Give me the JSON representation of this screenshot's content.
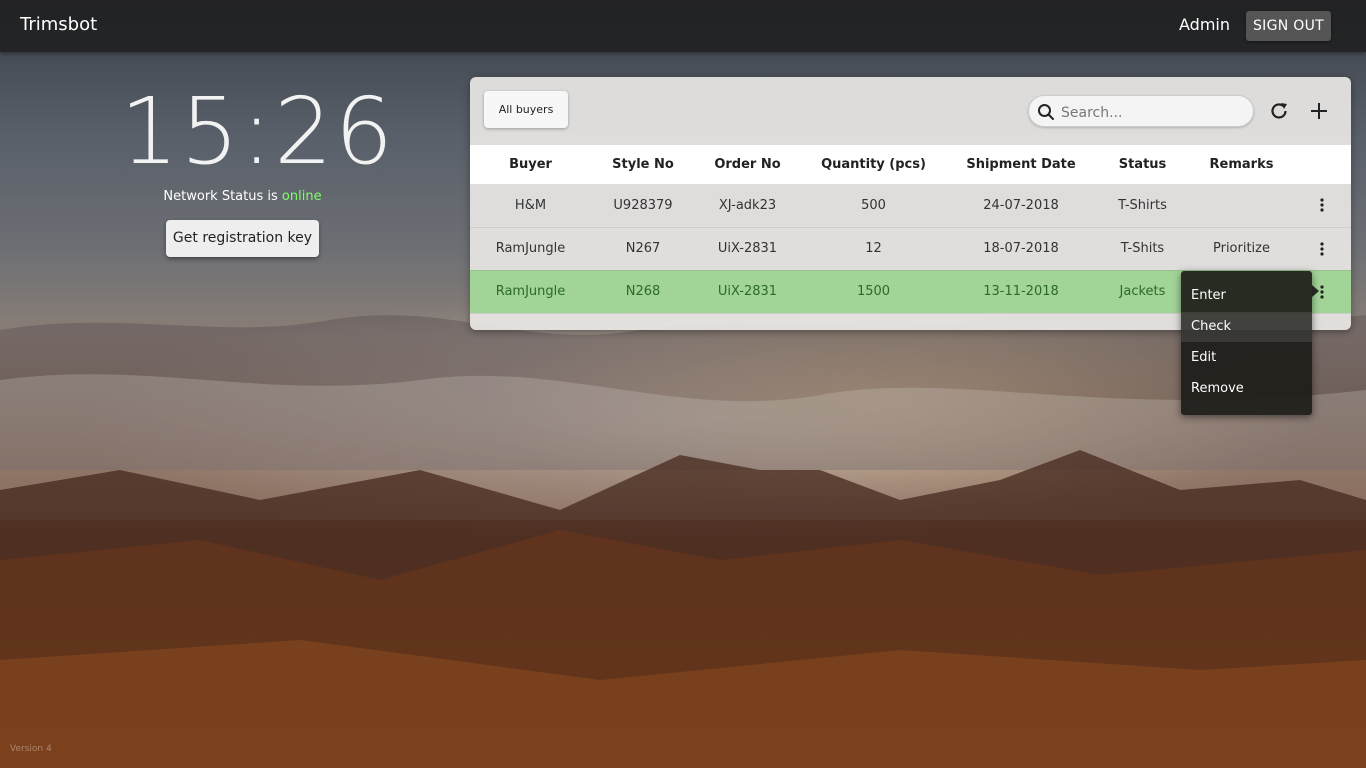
{
  "app": {
    "title": "Trimsbot",
    "version": "Version 4"
  },
  "header": {
    "user": "Admin",
    "signout_label": "SIGN OUT"
  },
  "clock": {
    "time": "15:26"
  },
  "network": {
    "prefix": "Network Status is ",
    "state": "online",
    "state_color": "#7dff6a"
  },
  "registration": {
    "button_label": "Get registration key"
  },
  "toolbar": {
    "filter_label": "All buyers",
    "search_placeholder": "Search...",
    "refresh_icon": "refresh-icon",
    "add_icon": "plus-icon"
  },
  "table": {
    "columns": [
      "Buyer",
      "Style No",
      "Order No",
      "Quantity (pcs)",
      "Shipment Date",
      "Status",
      "Remarks"
    ],
    "rows": [
      {
        "buyer": "H&M",
        "style_no": "U928379",
        "order_no": "XJ-adk23",
        "quantity": "500",
        "shipment_date": "24-07-2018",
        "status": "T-Shirts",
        "remarks": ""
      },
      {
        "buyer": "RamJungle",
        "style_no": "N267",
        "order_no": "UiX-2831",
        "quantity": "12",
        "shipment_date": "18-07-2018",
        "status": "T-Shits",
        "remarks": "Prioritize"
      },
      {
        "buyer": "RamJungle",
        "style_no": "N268",
        "order_no": "UiX-2831",
        "quantity": "1500",
        "shipment_date": "13-11-2018",
        "status": "Jackets",
        "remarks": ""
      }
    ],
    "selected_row_color": "#96d28c"
  },
  "context_menu": {
    "items": [
      "Enter",
      "Check",
      "Edit",
      "Remove"
    ],
    "hovered": "Check"
  }
}
